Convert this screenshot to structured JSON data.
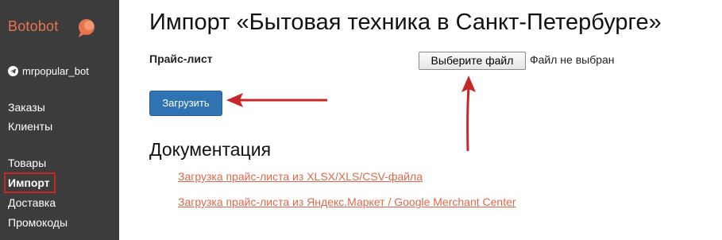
{
  "sidebar": {
    "brand": "Botobot",
    "bot_name": "mrpopular_bot",
    "items": [
      {
        "label": "Заказы"
      },
      {
        "label": "Клиенты"
      },
      {
        "label": "Товары"
      },
      {
        "label": "Импорт"
      },
      {
        "label": "Доставка"
      },
      {
        "label": "Промокоды"
      }
    ]
  },
  "main": {
    "title": "Импорт «Бытовая техника в Санкт-Петербурге»",
    "price_list_label": "Прайс-лист",
    "file_button_label": "Выберите файл",
    "file_status": "Файл не выбран",
    "upload_label": "Загрузить",
    "docs_heading": "Документация",
    "doc_links": [
      "Загрузка прайс-листа из XLSX/XLS/CSV-файла",
      "Загрузка прайс-листа из Яндекс.Маркет / Google Merchant Center"
    ]
  },
  "colors": {
    "sidebar_bg": "#3c3c3c",
    "brand": "#e8744f",
    "primary_button": "#2f73b3",
    "link": "#e0674a",
    "annotation": "#c62828"
  },
  "icons": {
    "brand_logo": "chat-bubble-icon",
    "bot": "telegram-icon"
  }
}
